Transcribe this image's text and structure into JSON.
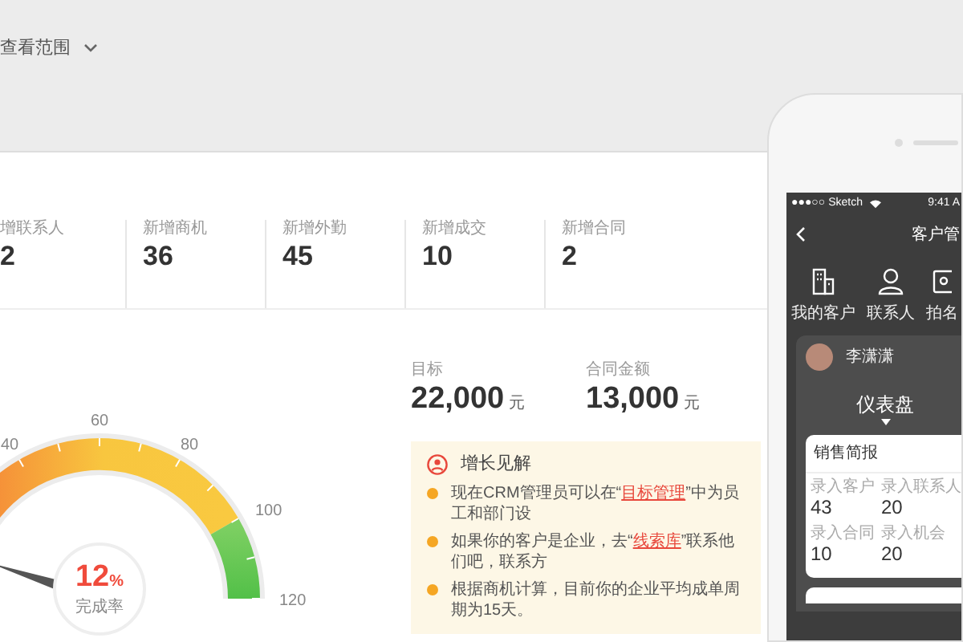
{
  "filter": {
    "label": "查看范围"
  },
  "stats": [
    {
      "label": "增联系人",
      "value": "2"
    },
    {
      "label": "新增商机",
      "value": "36"
    },
    {
      "label": "新增外勤",
      "value": "45"
    },
    {
      "label": "新增成交",
      "value": "10"
    },
    {
      "label": "新增合同",
      "value": "2"
    }
  ],
  "gauge": {
    "ticks": [
      "40",
      "60",
      "80",
      "100",
      "120"
    ],
    "value": "12",
    "unit": "%",
    "caption": "完成率"
  },
  "targets": [
    {
      "label": "目标",
      "value": "22,000",
      "unit": "元"
    },
    {
      "label": "合同金额",
      "value": "13,000",
      "unit": "元"
    }
  ],
  "insights": {
    "title": "增长见解",
    "items": [
      {
        "before": "现在CRM管理员可以在“",
        "link": "目标管理",
        "after": "”中为员工和部门设"
      },
      {
        "before": "如果你的客户是企业，去“",
        "link": "线索库",
        "after": "”联系他们吧，联系方"
      },
      {
        "before": "根据商机计算，目前你的企业平均成单周期为15天。"
      }
    ]
  },
  "phone": {
    "status": {
      "carrier": "●●●○○ Sketch",
      "time": "9:41 A"
    },
    "title": "客户管",
    "shortcuts": [
      {
        "kind": "building",
        "label": "我的客户"
      },
      {
        "kind": "person",
        "label": "联系人"
      },
      {
        "kind": "card",
        "label": "拍名"
      }
    ],
    "user": "李潇潇",
    "tab": "仪表盘",
    "report": {
      "title": "销售简报",
      "metrics": [
        {
          "label": "录入客户",
          "value": "43"
        },
        {
          "label": "录入联系人",
          "value": "20"
        },
        {
          "label": "录入合同",
          "value": "10"
        },
        {
          "label": "录入机会",
          "value": "20"
        }
      ]
    }
  }
}
